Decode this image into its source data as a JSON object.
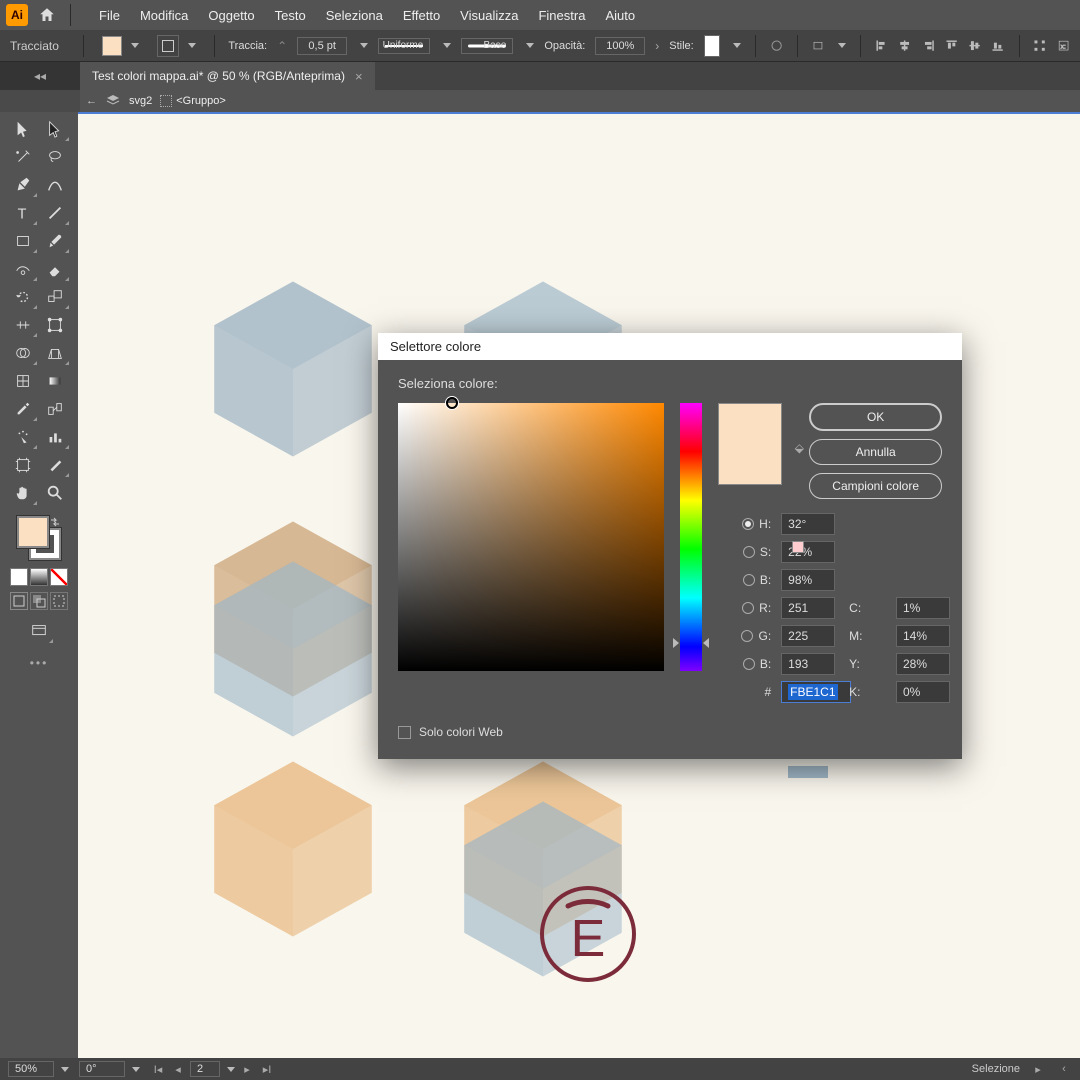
{
  "menubar": {
    "app": "Ai",
    "items": [
      "File",
      "Modifica",
      "Oggetto",
      "Testo",
      "Seleziona",
      "Effetto",
      "Visualizza",
      "Finestra",
      "Aiuto"
    ]
  },
  "pathbar": {
    "mode": "Tracciato",
    "traccia_label": "Traccia:",
    "stroke_weight": "0,5 pt",
    "dash_label": "Uniforme",
    "profile_label": "Base",
    "opacity_label": "Opacità:",
    "opacity_value": "100%",
    "style_label": "Stile:"
  },
  "tab": {
    "title": "Test colori mappa.ai* @ 50 % (RGB/Anteprima)",
    "close": "×"
  },
  "crumbs": {
    "layer": "svg2",
    "group": "<Gruppo>"
  },
  "color_picker": {
    "title": "Selettore colore",
    "select_label": "Seleziona colore:",
    "ok": "OK",
    "cancel": "Annulla",
    "swatches": "Campioni colore",
    "web_only": "Solo colori Web",
    "preview_color": "#FBE1C1",
    "H_label": "H:",
    "S_label": "S:",
    "B_label": "B:",
    "R_label": "R:",
    "G_label": "G:",
    "Bb_label": "B:",
    "H": "32°",
    "S": "22%",
    "B": "98%",
    "R": "251",
    "G": "225",
    "Bb": "193",
    "C_label": "C:",
    "M_label": "M:",
    "Y_label": "Y:",
    "K_label": "K:",
    "C": "1%",
    "M": "14%",
    "Y": "28%",
    "K": "0%",
    "hash": "#",
    "hex": "FBE1C1"
  },
  "statusbar": {
    "zoom": "50%",
    "angle": "0°",
    "page": "2",
    "tool": "Selezione"
  }
}
